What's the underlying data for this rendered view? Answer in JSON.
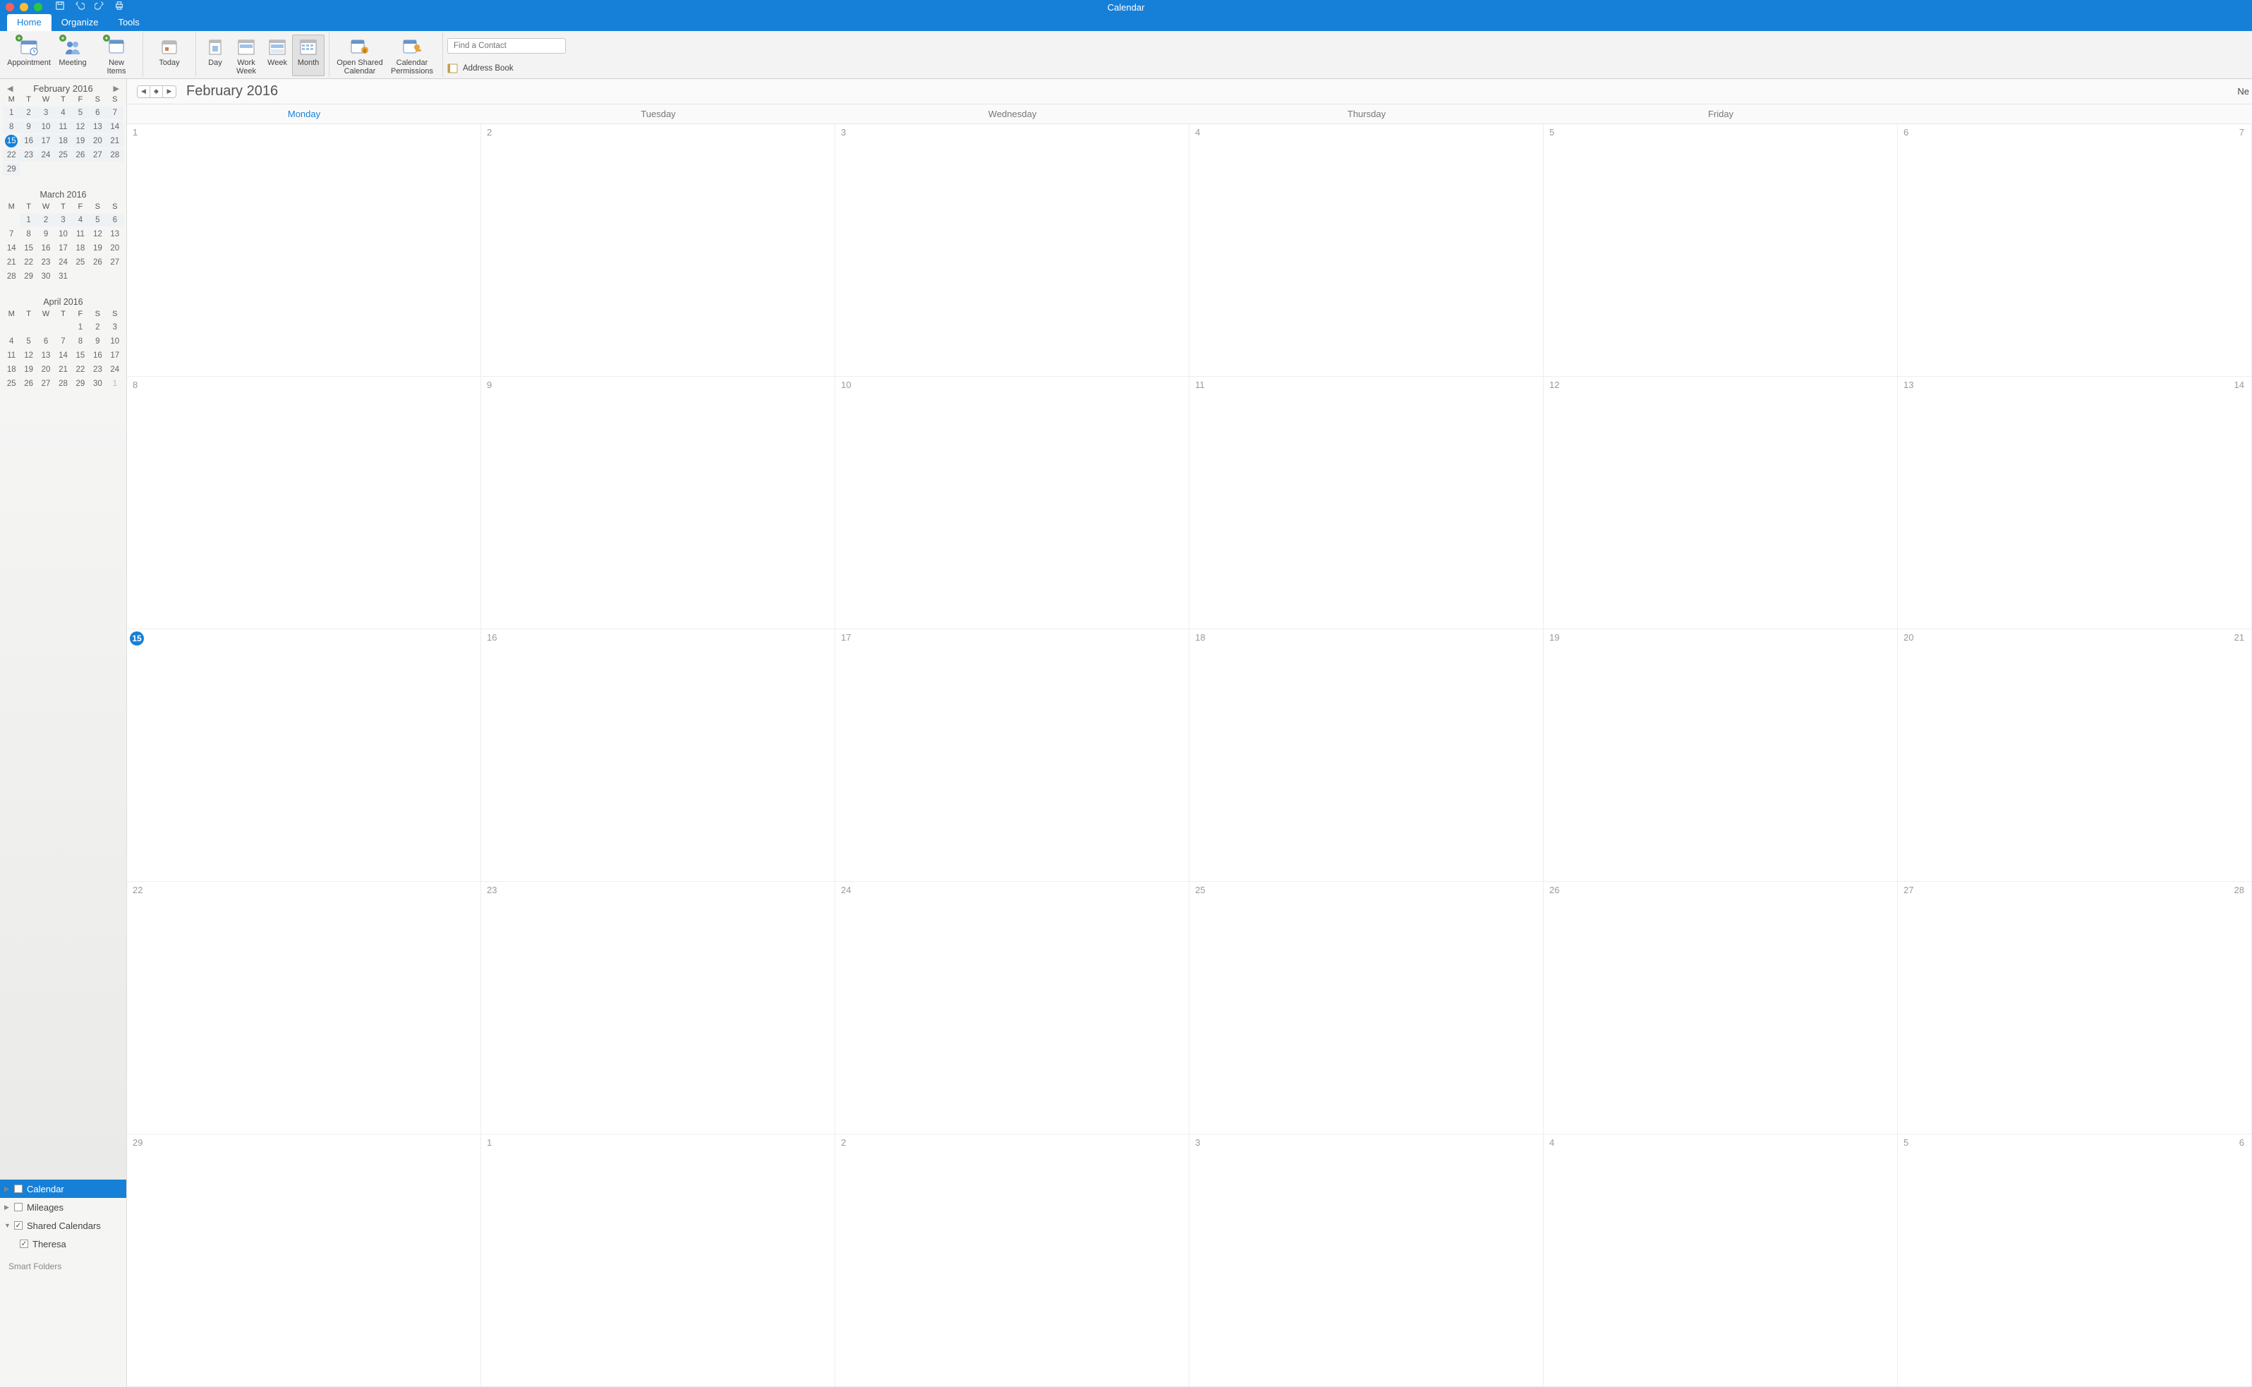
{
  "window": {
    "title": "Calendar"
  },
  "tabs": [
    "Home",
    "Organize",
    "Tools"
  ],
  "active_tab": 0,
  "ribbon": {
    "appointment": "Appointment",
    "meeting": "Meeting",
    "new_items": "New\nItems",
    "today": "Today",
    "day": "Day",
    "work_week": "Work\nWeek",
    "week": "Week",
    "month": "Month",
    "open_shared": "Open Shared\nCalendar",
    "cal_permissions": "Calendar\nPermissions",
    "find_contact_ph": "Find a Contact",
    "address_book": "Address Book"
  },
  "mini_nav_title": "February 2016",
  "mini_dow": [
    "M",
    "T",
    "W",
    "T",
    "F",
    "S",
    "S"
  ],
  "mini_months": [
    {
      "title": "February 2016",
      "show_title_in_nav": true,
      "offset": 0,
      "days": 29,
      "today": 15,
      "sel_from": 1,
      "sel_to": 29
    },
    {
      "title": "March 2016",
      "show_title_in_nav": false,
      "offset": 1,
      "days": 31,
      "today": 0,
      "sel_from": 1,
      "sel_to": 6
    },
    {
      "title": "April 2016",
      "show_title_in_nav": false,
      "offset": 4,
      "days": 30,
      "today": 0,
      "trail": 1,
      "sel_from": 0,
      "sel_to": 0
    }
  ],
  "caltree": {
    "calendar": "Calendar",
    "mileages": "Mileages",
    "shared": "Shared Calendars",
    "theresa": "Theresa",
    "smart": "Smart Folders"
  },
  "view_title": "February 2016",
  "corner_cut": "Ne",
  "weekdays": [
    "Monday",
    "Tuesday",
    "Wednesday",
    "Thursday",
    "Friday"
  ],
  "weekday_today_index": 0,
  "weekday_extra": "",
  "month_cells": [
    [
      "1",
      "2",
      "3",
      "4",
      "5",
      "6",
      "7"
    ],
    [
      "8",
      "9",
      "10",
      "11",
      "12",
      "13",
      "14"
    ],
    [
      "15",
      "16",
      "17",
      "18",
      "19",
      "20",
      "21"
    ],
    [
      "22",
      "23",
      "24",
      "25",
      "26",
      "27",
      "28"
    ],
    [
      "29",
      "1",
      "2",
      "3",
      "4",
      "5",
      "6"
    ]
  ],
  "today_cell": {
    "row": 2,
    "col": 0
  }
}
